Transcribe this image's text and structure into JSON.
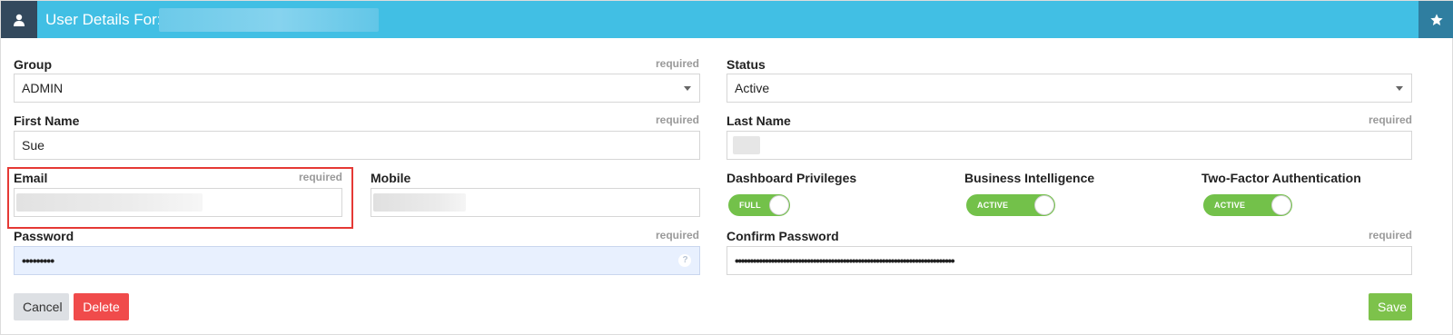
{
  "header": {
    "title": "User Details For:",
    "user_icon": "user-icon",
    "star_icon": "star-icon"
  },
  "form": {
    "group": {
      "label": "Group",
      "required": "required",
      "value": "ADMIN"
    },
    "status": {
      "label": "Status",
      "value": "Active"
    },
    "first_name": {
      "label": "First Name",
      "required": "required",
      "value": "Sue"
    },
    "last_name": {
      "label": "Last Name",
      "required": "required",
      "value": ""
    },
    "email": {
      "label": "Email",
      "required": "required",
      "value": ""
    },
    "mobile": {
      "label": "Mobile",
      "value": ""
    },
    "dashboard_privileges": {
      "label": "Dashboard Privileges",
      "value": "FULL"
    },
    "business_intelligence": {
      "label": "Business Intelligence",
      "value": "ACTIVE"
    },
    "two_factor": {
      "label": "Two-Factor Authentication",
      "value": "ACTIVE"
    },
    "password": {
      "label": "Password",
      "required": "required",
      "value": "•••••••••",
      "help": "?"
    },
    "confirm_password": {
      "label": "Confirm Password",
      "required": "required",
      "value": "•••••••••••••••••••••••••••••••••••••••••••••••••••••••••••••••••••••••••"
    }
  },
  "buttons": {
    "cancel": "Cancel",
    "delete": "Delete",
    "save": "Save"
  },
  "colors": {
    "header": "#41bfe4",
    "toggle_on": "#73c14a",
    "delete": "#f04b4b",
    "save": "#7dc24b",
    "highlight": "#e53935"
  }
}
